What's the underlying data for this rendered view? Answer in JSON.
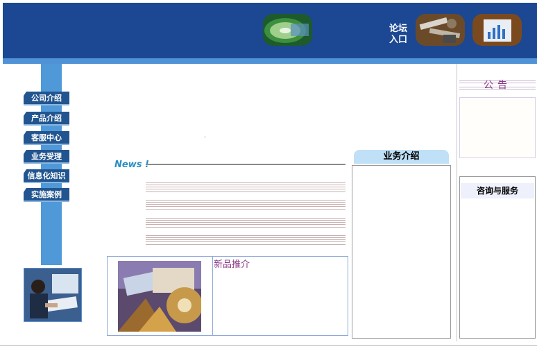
{
  "header": {
    "forum_line1": "论坛",
    "forum_line2": "入口"
  },
  "sidebar": {
    "items": [
      {
        "label": "公司介绍"
      },
      {
        "label": "产品介绍"
      },
      {
        "label": "客服中心"
      },
      {
        "label": "业务受理"
      },
      {
        "label": "信息化知识"
      },
      {
        "label": "实施案例"
      }
    ]
  },
  "main": {
    "dot": ".",
    "news_logo": "News !",
    "new_products_label": "新品推介"
  },
  "business": {
    "title": "业务介绍"
  },
  "notice": {
    "title": "公告"
  },
  "consult": {
    "title": "咨询与服务"
  },
  "colors": {
    "banner": "#1b4793",
    "banner_stripe": "#4f93d6",
    "nav_button": "#22558f",
    "accent_purple": "#8a3a86"
  }
}
